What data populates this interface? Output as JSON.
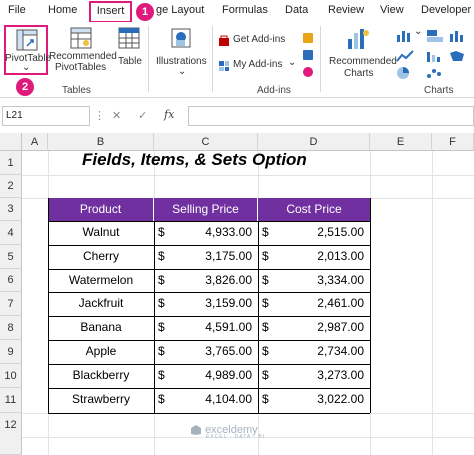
{
  "ribbon_tabs": {
    "file": "File",
    "home": "Home",
    "insert": "Insert",
    "page_layout": "ge Layout",
    "formulas": "Formulas",
    "data": "Data",
    "review": "Review",
    "view": "View",
    "developer": "Developer"
  },
  "step_badges": {
    "one": "1",
    "two": "2"
  },
  "ribbon": {
    "pivot_table": "PivotTable",
    "pivot_dropdown": "⌄",
    "recommended_pivot_line1": "Recommended",
    "recommended_pivot_line2": "PivotTables",
    "table": "Table",
    "tables_group": "Tables",
    "illustrations": "Illustrations",
    "get_addins": "Get Add-ins",
    "my_addins": "My Add-ins",
    "addins_group": "Add-ins",
    "recommended_charts_line1": "Recommended",
    "recommended_charts_line2": "Charts",
    "charts_group": "Charts"
  },
  "formula_bar": {
    "name_box": "L21",
    "cancel": "✕",
    "enter": "✓",
    "fx": "fx",
    "formula": ""
  },
  "columns": [
    "A",
    "B",
    "C",
    "D",
    "E",
    "F"
  ],
  "rows": [
    "1",
    "2",
    "3",
    "4",
    "5",
    "6",
    "7",
    "8",
    "9",
    "10",
    "11",
    "12"
  ],
  "sheet_title": "Fields, Items, & Sets Option",
  "table": {
    "headers": [
      "Product",
      "Selling Price",
      "Cost Price"
    ],
    "currency": "$",
    "rows": [
      {
        "product": "Walnut",
        "selling": "4,933.00",
        "cost": "2,515.00"
      },
      {
        "product": "Cherry",
        "selling": "3,175.00",
        "cost": "2,013.00"
      },
      {
        "product": "Watermelon",
        "selling": "3,826.00",
        "cost": "3,334.00"
      },
      {
        "product": "Jackfruit",
        "selling": "3,159.00",
        "cost": "2,461.00"
      },
      {
        "product": "Banana",
        "selling": "4,591.00",
        "cost": "2,987.00"
      },
      {
        "product": "Apple",
        "selling": "3,765.00",
        "cost": "2,734.00"
      },
      {
        "product": "Blackberry",
        "selling": "4,989.00",
        "cost": "3,273.00"
      },
      {
        "product": "Strawberry",
        "selling": "4,104.00",
        "cost": "3,022.00"
      }
    ]
  },
  "watermark": {
    "name": "exceldemy",
    "tagline": "EXCEL · DATA · BI"
  },
  "colors": {
    "header_fill": "#7030a0",
    "highlight": "#e0197d"
  }
}
